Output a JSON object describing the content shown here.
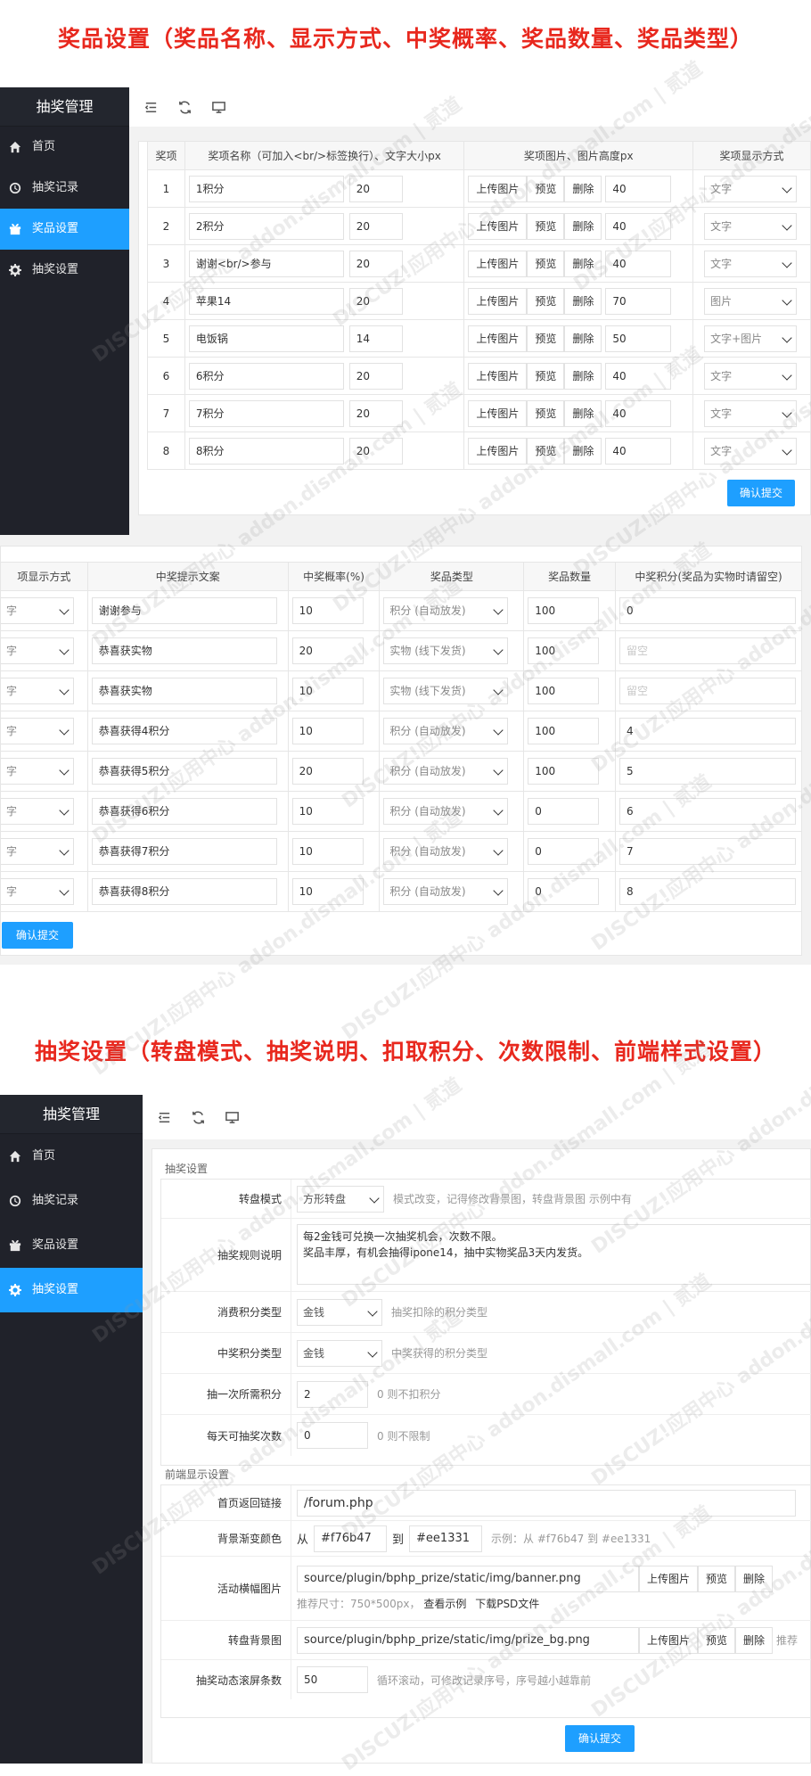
{
  "headline1": "奖品设置（奖品名称、显示方式、中奖概率、奖品数量、奖品类型）",
  "headline2": "抽奖设置（转盘模式、抽奖说明、扣取积分、次数限制、前端样式设置）",
  "sidebar": {
    "title": "抽奖管理",
    "items": [
      {
        "label": "首页",
        "icon": "home-icon"
      },
      {
        "label": "抽奖记录",
        "icon": "clock-icon"
      },
      {
        "label": "奖品设置",
        "icon": "gift-icon"
      },
      {
        "label": "抽奖设置",
        "icon": "gear-icon"
      }
    ]
  },
  "colors": {
    "accent": "#1e9fff",
    "sidebar": "#20222a",
    "headline": "#e8281e"
  },
  "prize_table": {
    "headers": [
      "奖项",
      "奖项名称（可加入<br/>标签换行）、文字大小px",
      "奖项图片、图片高度px",
      "奖项显示方式"
    ],
    "upload_label": "上传图片",
    "preview_label": "预览",
    "delete_label": "删除",
    "rows": [
      {
        "no": "1",
        "name": "1积分",
        "size": "20",
        "img_h": "40",
        "display": "文字"
      },
      {
        "no": "2",
        "name": "2积分",
        "size": "20",
        "img_h": "40",
        "display": "文字"
      },
      {
        "no": "3",
        "name": "谢谢<br/>参与",
        "size": "20",
        "img_h": "40",
        "display": "文字"
      },
      {
        "no": "4",
        "name": "苹果14",
        "size": "20",
        "img_h": "70",
        "display": "图片"
      },
      {
        "no": "5",
        "name": "电饭锅",
        "size": "14",
        "img_h": "50",
        "display": "文字+图片"
      },
      {
        "no": "6",
        "name": "6积分",
        "size": "20",
        "img_h": "40",
        "display": "文字"
      },
      {
        "no": "7",
        "name": "7积分",
        "size": "20",
        "img_h": "40",
        "display": "文字"
      },
      {
        "no": "8",
        "name": "8积分",
        "size": "20",
        "img_h": "40",
        "display": "文字"
      }
    ],
    "submit": "确认提交"
  },
  "prize_table2": {
    "headers": [
      "项显示方式",
      "中奖提示文案",
      "中奖概率(%)",
      "奖品类型",
      "奖品数量",
      "中奖积分(奖品为实物时请留空)"
    ],
    "display_partial": "字",
    "rows": [
      {
        "tip": "谢谢参与",
        "rate": "10",
        "type": "积分 (自动放发)",
        "qty": "100",
        "points": "0",
        "ph": false
      },
      {
        "tip": "恭喜获实物",
        "rate": "20",
        "type": "实物 (线下发货)",
        "qty": "100",
        "points": "留空",
        "ph": true
      },
      {
        "tip": "恭喜获实物",
        "rate": "10",
        "type": "实物 (线下发货)",
        "qty": "100",
        "points": "留空",
        "ph": true
      },
      {
        "tip": "恭喜获得4积分",
        "rate": "10",
        "type": "积分 (自动放发)",
        "qty": "100",
        "points": "4",
        "ph": false
      },
      {
        "tip": "恭喜获得5积分",
        "rate": "20",
        "type": "积分 (自动放发)",
        "qty": "100",
        "points": "5",
        "ph": false
      },
      {
        "tip": "恭喜获得6积分",
        "rate": "10",
        "type": "积分 (自动放发)",
        "qty": "0",
        "points": "6",
        "ph": false
      },
      {
        "tip": "恭喜获得7积分",
        "rate": "10",
        "type": "积分 (自动放发)",
        "qty": "0",
        "points": "7",
        "ph": false
      },
      {
        "tip": "恭喜获得8积分",
        "rate": "10",
        "type": "积分 (自动放发)",
        "qty": "0",
        "points": "8",
        "ph": false
      }
    ],
    "submit": "确认提交"
  },
  "settings": {
    "section1": "抽奖设置",
    "mode_label": "转盘模式",
    "mode_value": "方形转盘",
    "mode_hint": "模式改变，记得修改背景图，转盘背景图 示例中有",
    "rules_label": "抽奖规则说明",
    "rules_line1": "每2金钱可兑换一次抽奖机会，次数不限。",
    "rules_line2": "奖品丰厚，有机会抽得ipone14，抽中实物奖品3天内发货。",
    "cost_type_label": "消费积分类型",
    "cost_type_value": "金钱",
    "cost_type_hint": "抽奖扣除的积分类型",
    "win_type_label": "中奖积分类型",
    "win_type_value": "金钱",
    "win_type_hint": "中奖获得的积分类型",
    "cost_label": "抽一次所需积分",
    "cost_value": "2",
    "cost_hint": "0 则不扣积分",
    "daily_label": "每天可抽奖次数",
    "daily_value": "0",
    "daily_hint": "0 则不限制",
    "section2": "前端显示设置",
    "home_label": "首页返回链接",
    "home_value": "/forum.php",
    "grad_label": "背景渐变颜色",
    "grad_from": "从",
    "grad_c1": "#f76b47",
    "grad_to": "到",
    "grad_c2": "#ee1331",
    "grad_hint": "示例：从 #f76b47 到 #ee1331",
    "banner_label": "活动横幅图片",
    "banner_value": "source/plugin/bphp_prize/static/img/banner.png",
    "banner_hint": "推荐尺寸：750*500px，",
    "banner_example": "查看示例",
    "banner_psd": "下载PSD文件",
    "wheel_label": "转盘背景图",
    "wheel_value": "source/plugin/bphp_prize/static/img/prize_bg.png",
    "wheel_hint": "推荐",
    "scroll_label": "抽奖动态滚屏条数",
    "scroll_value": "50",
    "scroll_hint": "循环滚动，可修改记录序号，序号越小越靠前",
    "upload_label": "上传图片",
    "preview_label": "预览",
    "delete_label": "删除",
    "submit": "确认提交"
  },
  "watermark": "DISCUZ!应用中心 addon.dismall.com | 贰道"
}
